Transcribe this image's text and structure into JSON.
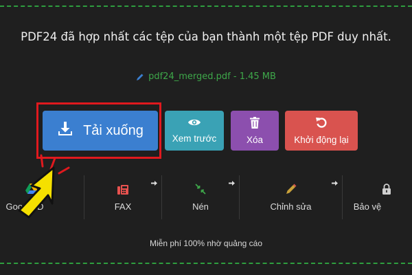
{
  "header": {
    "message": "PDF24 đã hợp nhất các tệp của bạn thành một tệp PDF duy nhất.",
    "file_name": "pdf24_merged.pdf",
    "file_separator": " - ",
    "file_size": "1.45 MB"
  },
  "actions": {
    "download_label": "Tải xuống",
    "preview_label": "Xem trước",
    "delete_label": "Xóa",
    "restart_label": "Khởi động lại"
  },
  "tools": [
    {
      "label": "Google D",
      "icon": "google-drive-icon"
    },
    {
      "label": "FAX",
      "icon": "fax-icon"
    },
    {
      "label": "Nén",
      "icon": "compress-icon"
    },
    {
      "label": "Chỉnh sửa",
      "icon": "pencil-icon"
    },
    {
      "label": "Bảo vệ",
      "icon": "lock-icon"
    }
  ],
  "footer": {
    "text": "Miễn phí 100% nhờ quảng cáo"
  },
  "colors": {
    "background": "#1f1f1f",
    "dashed_border": "#2e9e3f",
    "file_text": "#3ea84a",
    "download": "#3b7fd0",
    "preview": "#3aa2b5",
    "delete": "#8c4fae",
    "restart": "#d9534f",
    "highlight": "#e0191e",
    "cursor": "#f5e000"
  }
}
